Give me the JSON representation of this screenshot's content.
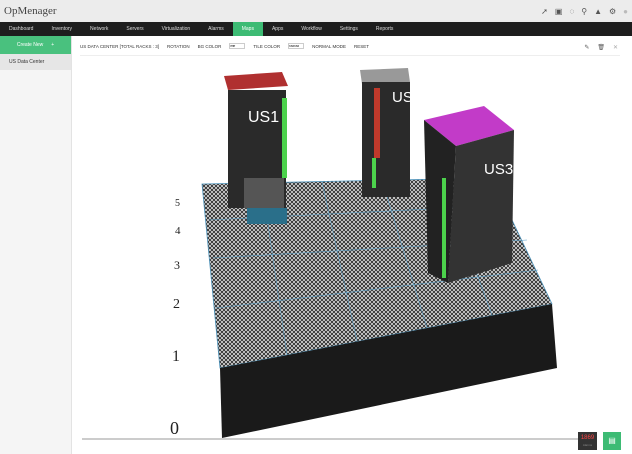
{
  "app": {
    "title": "OpMenager"
  },
  "top_icons": [
    "rocket-icon",
    "play-icon",
    "bulb-icon",
    "search-icon",
    "bell-icon",
    "gear-icon",
    "user-icon"
  ],
  "nav": [
    "Dashboard",
    "Inventory",
    "Network",
    "Servers",
    "Virtualization",
    "Alarms",
    "Maps",
    "Apps",
    "Workflow",
    "Settings",
    "Reports"
  ],
  "nav_active": "Maps",
  "sidebar": {
    "create": "Create New",
    "create_icon": "+",
    "items": [
      "US Data Center"
    ]
  },
  "toolbar": {
    "title": "US DATA CENTER [TOTAL RACKS : 3]",
    "rotation": "ROTATION",
    "bg_color_label": "BG COLOR",
    "bg_color_value": "ffffff",
    "tile_color_label": "TILE COLOR",
    "tile_color_value": "666666",
    "normal_mode": "NORMAL MODE",
    "reset": "RESET"
  },
  "racks": [
    {
      "name": "US1",
      "color": "#c0392b"
    },
    {
      "name": "US2",
      "color": "#c0392b"
    },
    {
      "name": "US3",
      "color": "#c23bc8"
    }
  ],
  "axis": [
    "0",
    "1",
    "2",
    "3",
    "4",
    "5"
  ],
  "alarms": {
    "count": "1869",
    "label": "Alarms"
  },
  "colors": {
    "accent": "#3dbb74",
    "nav": "#1e1e1e"
  }
}
